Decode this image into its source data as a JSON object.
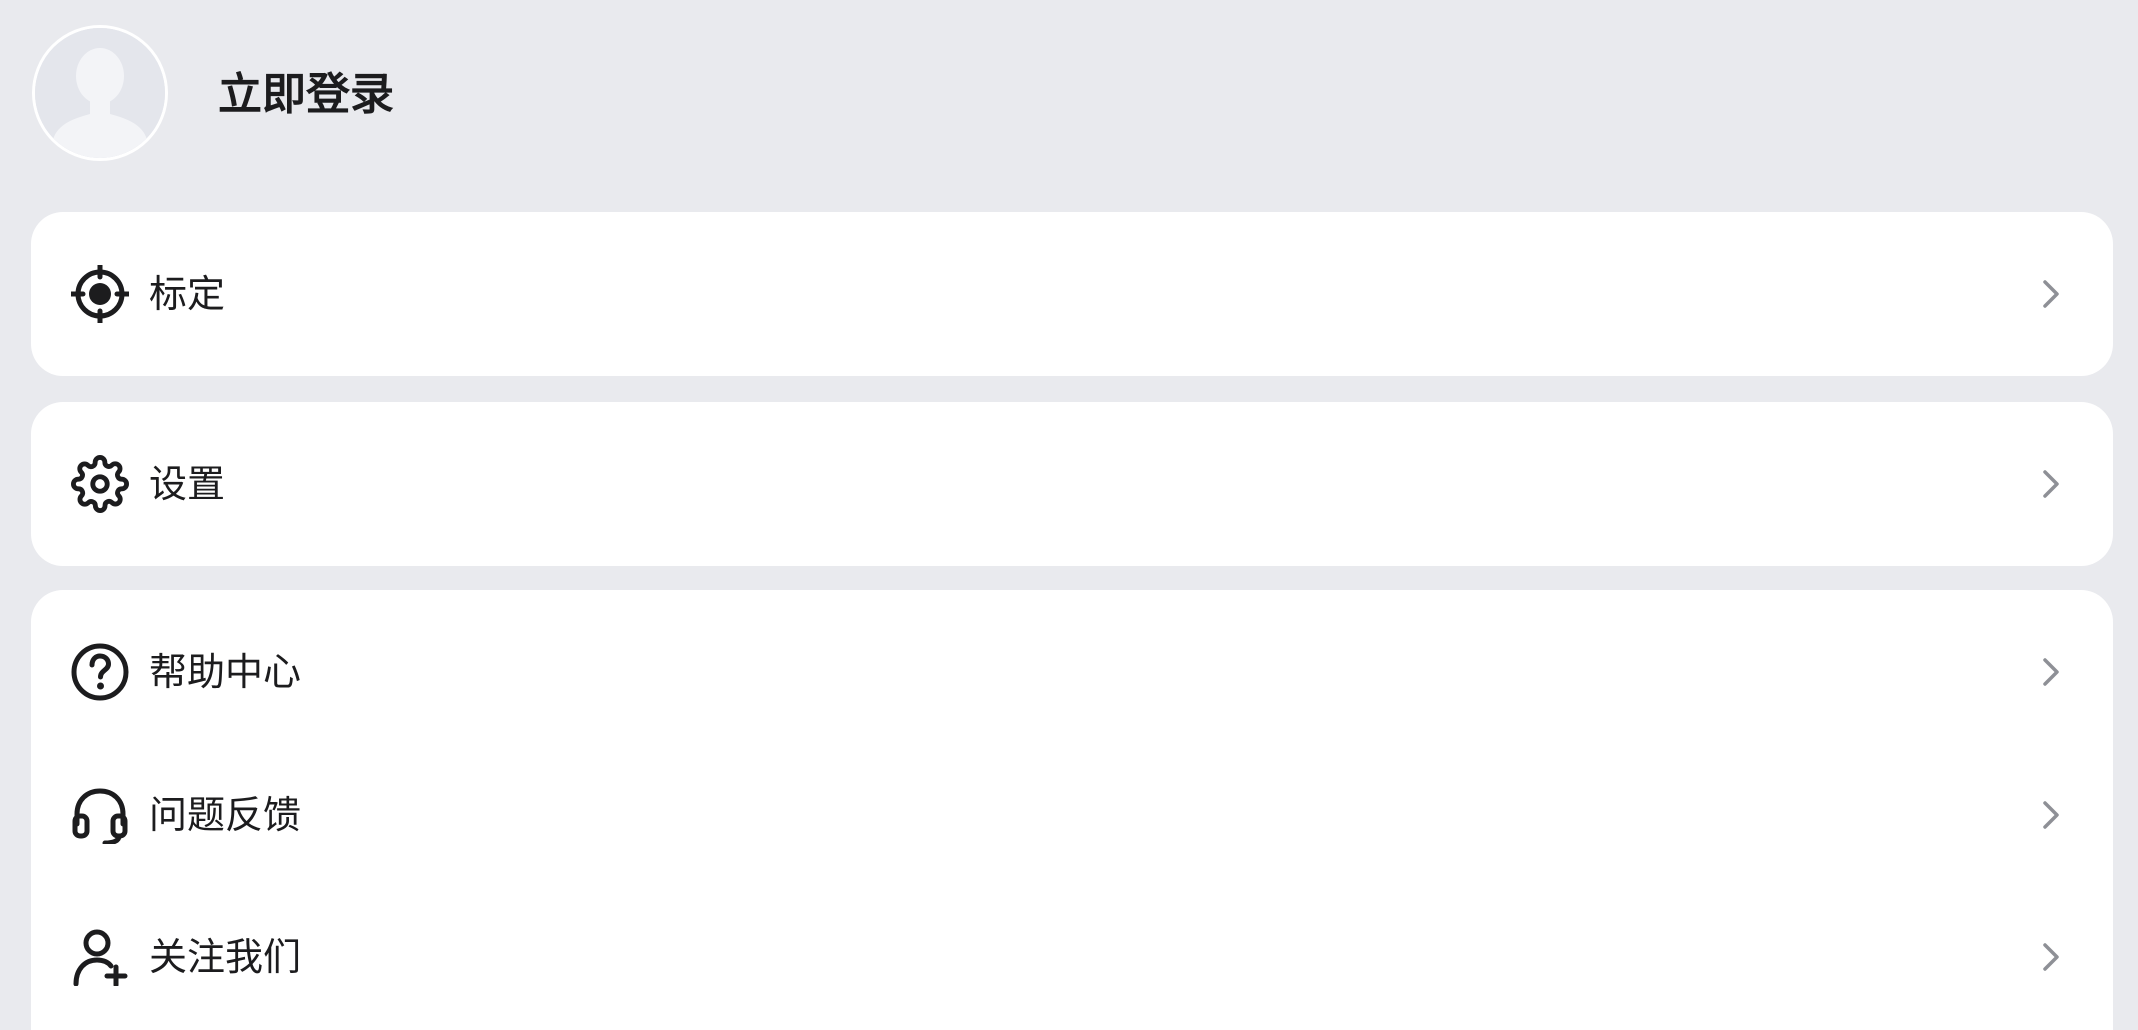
{
  "header": {
    "login_label": "立即登录"
  },
  "menu": {
    "calibrate": {
      "label": "标定",
      "icon": "crosshair-icon"
    },
    "settings": {
      "label": "设置",
      "icon": "gear-icon"
    },
    "help_center": {
      "label": "帮助中心",
      "icon": "question-circle-icon"
    },
    "feedback": {
      "label": "问题反馈",
      "icon": "headset-icon"
    },
    "follow_us": {
      "label": "关注我们",
      "icon": "user-plus-icon"
    }
  },
  "colors": {
    "page_background": "#e9eaee",
    "card_background": "#ffffff",
    "text": "#1c1c1e",
    "chevron": "#8e9096",
    "avatar_background": "#e4e6ec"
  }
}
